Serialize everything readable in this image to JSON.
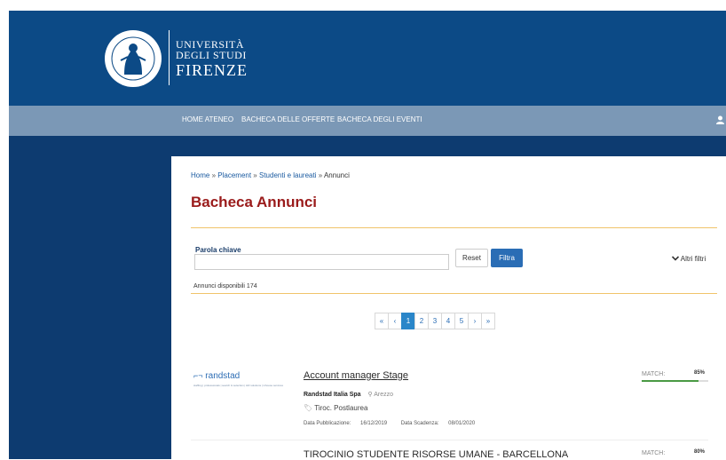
{
  "header": {
    "logo": {
      "line1": "UNIVERSITÀ",
      "line2": "DEGLI STUDI",
      "line3": "FIRENZE",
      "seal_text": "FLORENTINA STUDIORUM UNIVERSITAS"
    }
  },
  "nav": {
    "items": [
      "HOME ATENEO",
      "BACHECA DELLE OFFERTE",
      "BACHECA DEGLI EVENTI"
    ],
    "user_icon": "user-icon"
  },
  "breadcrumb": {
    "items": [
      "Home",
      "Placement",
      "Studenti e laureati"
    ],
    "current": "Annunci",
    "separator": "»"
  },
  "page": {
    "title": "Bacheca Annunci"
  },
  "filters": {
    "keyword_label": "Parola chiave",
    "keyword_value": "",
    "keyword_placeholder": "",
    "reset_label": "Reset",
    "filter_label": "Filtra",
    "more_filters_label": "Altri filtri"
  },
  "results": {
    "count_text": "Annunci disponibili 174"
  },
  "pagination": {
    "first": "«",
    "prev": "‹",
    "pages": [
      "1",
      "2",
      "3",
      "4",
      "5"
    ],
    "active": "1",
    "next": "›",
    "last": "»"
  },
  "listings": [
    {
      "logo_name": "randstad",
      "logo_tagline": "staffing | professionals | search & selection | HR solutions | inhouse services",
      "title": "Account manager Stage",
      "company": "Randstad Italia Spa",
      "location": "Arezzo",
      "type": "Tiroc. Postlaurea",
      "pub_label": "Data Pubblicazione:",
      "pub_date": "16/12/2019",
      "exp_label": "Data Scadenza:",
      "exp_date": "08/01/2020",
      "match_label": "MATCH:",
      "match_value": "85%",
      "match_fraction": 0.85
    },
    {
      "title": "TIROCINIO STUDENTE RISORSE UMANE - BARCELLONA",
      "match_label": "MATCH:",
      "match_value": "80%"
    }
  ],
  "colors": {
    "header": "#0c4a86",
    "navbar": "#7b98b6",
    "background": "#0d3b70",
    "title": "#9a1b1b",
    "accent": "#2a6db5",
    "match": "#4a9a44"
  }
}
